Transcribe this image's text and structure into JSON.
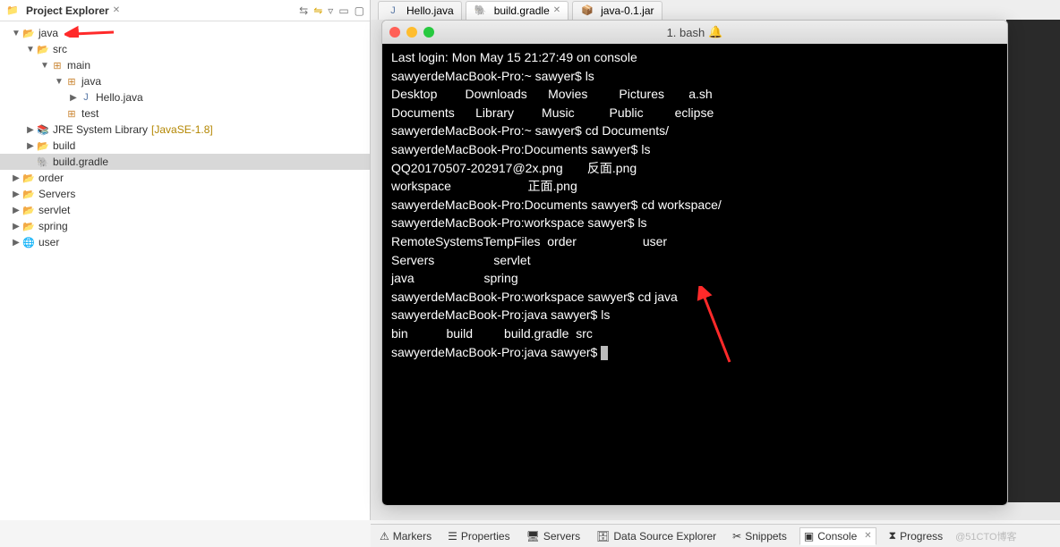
{
  "sidebar": {
    "title": "Project Explorer",
    "tree": {
      "java": "java",
      "src": "src",
      "main": "main",
      "java_pkg": "java",
      "hello": "Hello.java",
      "test": "test",
      "jre": "JRE System Library",
      "jre_dec": "[JavaSE-1.8]",
      "build_dir": "build",
      "gradle": "build.gradle",
      "order": "order",
      "servers": "Servers",
      "servlet": "servlet",
      "spring": "spring",
      "user": "user"
    }
  },
  "tabs": {
    "hello": "Hello.java",
    "gradle": "build.gradle",
    "jar": "java-0.1.jar"
  },
  "terminal": {
    "title": "1. bash",
    "lines": [
      "Last login: Mon May 15 21:27:49 on console",
      "sawyerdeMacBook-Pro:~ sawyer$ ls",
      "Desktop        Downloads      Movies         Pictures       a.sh",
      "Documents      Library        Music          Public         eclipse",
      "sawyerdeMacBook-Pro:~ sawyer$ cd Documents/",
      "sawyerdeMacBook-Pro:Documents sawyer$ ls",
      "QQ20170507-202917@2x.png       反面.png",
      "workspace                      正面.png",
      "sawyerdeMacBook-Pro:Documents sawyer$ cd workspace/",
      "sawyerdeMacBook-Pro:workspace sawyer$ ls",
      "RemoteSystemsTempFiles  order                   user",
      "Servers                 servlet",
      "java                    spring",
      "sawyerdeMacBook-Pro:workspace sawyer$ cd java",
      "sawyerdeMacBook-Pro:java sawyer$ ls",
      "bin           build         build.gradle  src",
      "sawyerdeMacBook-Pro:java sawyer$ "
    ]
  },
  "bottom": {
    "markers": "Markers",
    "properties": "Properties",
    "servers": "Servers",
    "dse": "Data Source Explorer",
    "snippets": "Snippets",
    "console": "Console",
    "progress": "Progress",
    "watermark": "@51CTO博客"
  }
}
